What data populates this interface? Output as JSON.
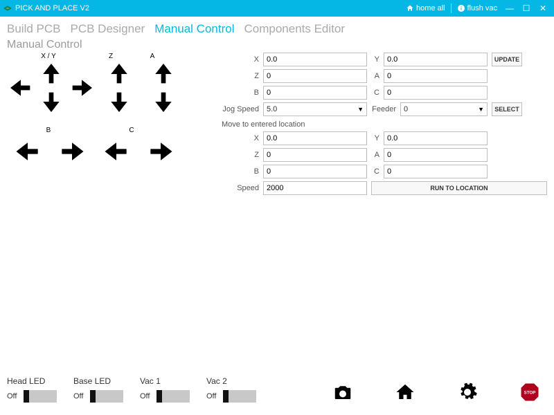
{
  "window": {
    "title": "PICK AND PLACE V2",
    "home_all": "home all",
    "flush_vac": "flush vac"
  },
  "tabs": [
    "Build PCB",
    "PCB Designer",
    "Manual Control",
    "Components Editor"
  ],
  "active_tab": 2,
  "subtitle": "Manual Control",
  "axis_labels": {
    "xy": "X / Y",
    "z": "Z",
    "a": "A",
    "b": "B",
    "c": "C"
  },
  "current": {
    "x_label": "X",
    "x": "0.0",
    "y_label": "Y",
    "y": "0.0",
    "z_label": "Z",
    "z": "0",
    "a_label": "A",
    "a": "0",
    "b_label": "B",
    "b": "0",
    "c_label": "C",
    "c": "0",
    "jog_label": "Jog Speed",
    "jog": "5.0",
    "feeder_label": "Feeder",
    "feeder": "0",
    "update_btn": "UPDATE",
    "select_btn": "SELECT"
  },
  "move": {
    "title": "Move to entered location",
    "x_label": "X",
    "x": "0.0",
    "y_label": "Y",
    "y": "0.0",
    "z_label": "Z",
    "z": "0",
    "a_label": "A",
    "a": "0",
    "b_label": "B",
    "b": "0",
    "c_label": "C",
    "c": "0",
    "speed_label": "Speed",
    "speed": "2000",
    "run_btn": "RUN TO LOCATION"
  },
  "toggles": [
    {
      "label": "Head LED",
      "state": "Off"
    },
    {
      "label": "Base LED",
      "state": "Off"
    },
    {
      "label": "Vac 1",
      "state": "Off"
    },
    {
      "label": "Vac 2",
      "state": "Off"
    }
  ]
}
